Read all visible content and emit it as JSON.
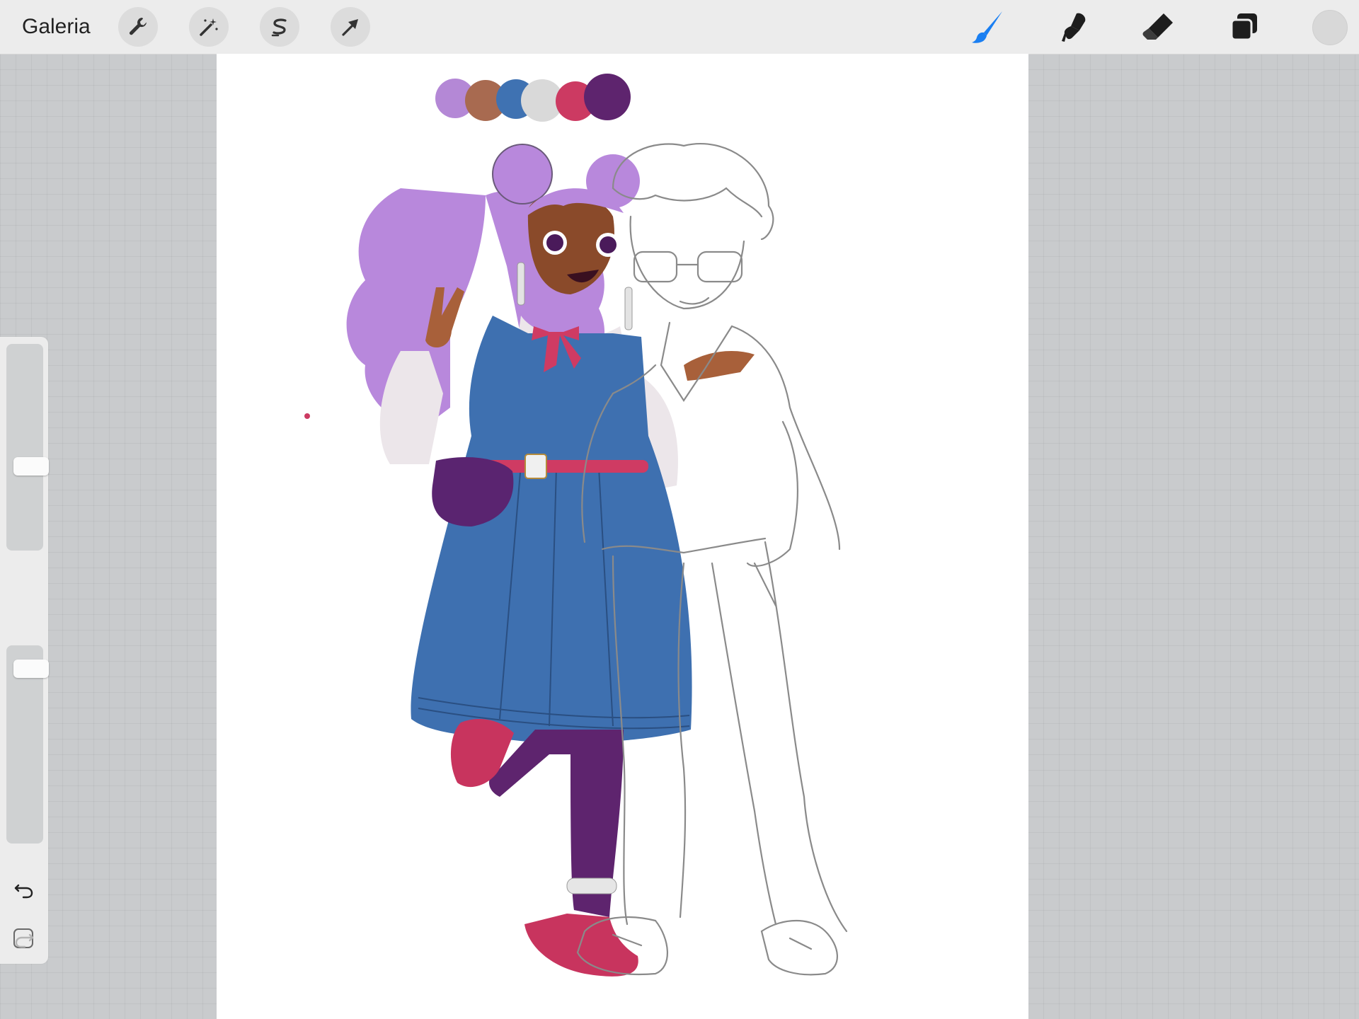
{
  "toolbar": {
    "gallery_label": "Galeria",
    "left_tools": [
      {
        "name": "actions",
        "icon": "wrench-icon"
      },
      {
        "name": "adjustments",
        "icon": "magic-wand-icon"
      },
      {
        "name": "selection",
        "icon": "selection-s-icon"
      },
      {
        "name": "transform",
        "icon": "arrow-cursor-icon"
      }
    ],
    "right_tools": [
      {
        "name": "brush",
        "icon": "brush-icon",
        "active": true
      },
      {
        "name": "smudge",
        "icon": "smudge-icon"
      },
      {
        "name": "eraser",
        "icon": "eraser-icon"
      },
      {
        "name": "layers",
        "icon": "layers-icon"
      }
    ],
    "current_color": "#d8d8d8",
    "active_color": "#1a7ff2"
  },
  "sidebar": {
    "brush_size_level": 0.4,
    "opacity_level": 0.08,
    "modifier_icon": "square-modifier-icon",
    "undo_icon": "undo-icon",
    "redo_icon": "redo-icon"
  },
  "canvas": {
    "palette": [
      "#b488d6",
      "#a86a50",
      "#3f72b2",
      "#d9d9d9",
      "#cc3a62",
      "#5e246e"
    ],
    "colors": {
      "hair": "#b888dc",
      "skin": "#8a4a2a",
      "dress": "#3e70b0",
      "blouse": "#ece6ea",
      "bow": "#cf3b63",
      "tights": "#5e246e",
      "shoes": "#c8345e",
      "bag": "#5a2470",
      "lineart": "#8a8a8a"
    }
  }
}
